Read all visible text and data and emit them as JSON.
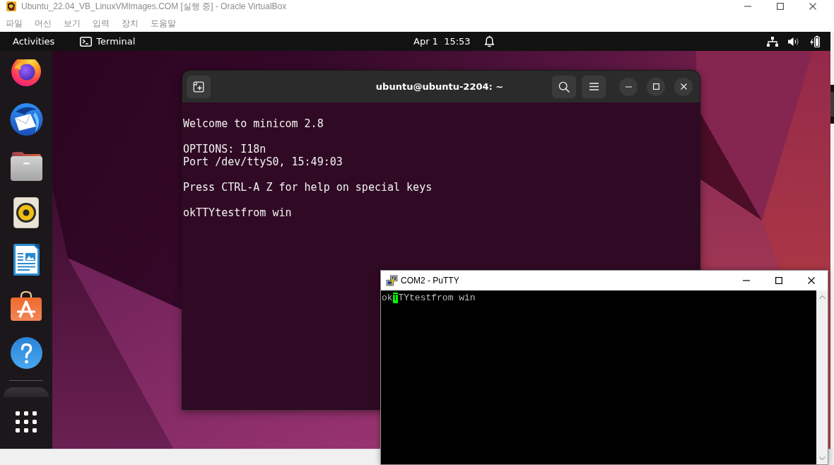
{
  "virtualbox": {
    "title": "Ubuntu_22.04_VB_LinuxVMImages.COM [실행 중] - Oracle VirtualBox",
    "menu": [
      "파일",
      "머신",
      "보기",
      "입력",
      "장치",
      "도움말"
    ]
  },
  "top_bar": {
    "activities": "Activities",
    "app_menu": "Terminal",
    "clock": "Apr 1  15:53"
  },
  "terminal": {
    "title": "ubuntu@ubuntu-2204: ~",
    "paragraphs": [
      [
        "Welcome to minicom 2.8"
      ],
      [
        "OPTIONS: I18n",
        "Port /dev/ttyS0, 15:49:03"
      ],
      [
        "Press CTRL-A Z for help on special keys"
      ],
      [
        "okTTYtestfrom win"
      ]
    ]
  },
  "putty": {
    "title": "COM2 - PuTTY",
    "lines": [
      {
        "segments": [
          {
            "text": "ok",
            "cursor": false
          },
          {
            "text": "T",
            "cursor": true
          },
          {
            "text": "TYtestfrom win",
            "cursor": false
          }
        ]
      }
    ]
  }
}
